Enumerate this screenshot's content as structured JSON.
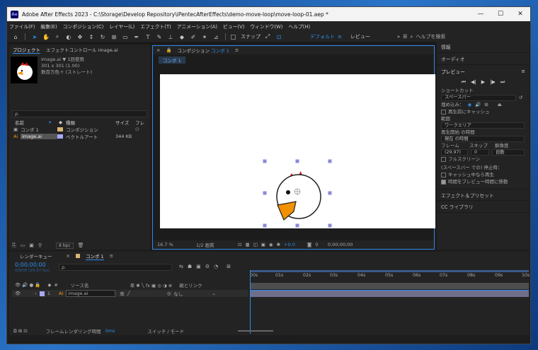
{
  "app": {
    "title": "Adobe After Effects 2023 - C:\\Storage\\Develop Repository\\iPentecAfterEffects\\demo-move-loop\\move-loop-01.aep *",
    "logo": "Ae"
  },
  "menu": [
    "ファイル(F)",
    "編集(E)",
    "コンポジション(C)",
    "レイヤー(L)",
    "エフェクト(T)",
    "アニメーション(A)",
    "ビュー(V)",
    "ウィンドウ(W)",
    "ヘルプ(H)"
  ],
  "toolbar": {
    "snap_label": "スナップ",
    "workspace_default": "デフォルト",
    "workspace_review": "レビュー",
    "help_search_placeholder": "ヘルプを検索"
  },
  "project": {
    "tab_project": "プロジェクト",
    "tab_effects": "エフェクトコントロール image.ai",
    "asset_name": "image.ai",
    "asset_used": "▼ 1回使用",
    "asset_size": "301 x 301 (1.00)",
    "asset_color": "数百万色＋ (ストレート)",
    "search_placeholder": "ρ.",
    "columns": [
      "名前",
      "種類",
      "サイズ",
      "フレ"
    ],
    "items": [
      {
        "name": "コンポ 1",
        "type": "コンポジション",
        "size": ""
      },
      {
        "name": "image.ai",
        "type": "ベクトルアート",
        "size": "344 KB"
      }
    ],
    "bpc": "8 bpc"
  },
  "composition": {
    "tab": "コンポジション",
    "tab_comp": "コンポ 1",
    "breadcrumb": "コンポ 1",
    "zoom": "16.7 %",
    "resolution": "1/2 画質",
    "exposure": "+0.0",
    "timecode": "0;00;00;00"
  },
  "side": {
    "info": "情報",
    "audio": "オーディオ",
    "preview": "プレビュー",
    "shortcut_label": "ショートカット",
    "shortcut_value": "スペースバー",
    "include_label": "埋め込み：",
    "cache_before": "再生前にキャッシュ",
    "range_label": "範囲",
    "range_value": "ワークエリア",
    "start_label": "再生開始 の時間",
    "start_value": "現在 の時間",
    "frame_label": "フレーム",
    "skip_label": "スキップ",
    "res_label": "解像度",
    "frame_value": "(29.97)",
    "skip_value": "0",
    "res_value": "自動",
    "fullscreen": "フルスクリーン",
    "stop_label": "(スペースバー での) 停止時：",
    "stop_cache": "キャッシュ中なら再生",
    "stop_time": "時間をプレビュー時間に移動",
    "effects_presets": "エフェクト＆プリセット",
    "cc_library": "CC ライブラリ"
  },
  "timeline": {
    "tab_render": "レンダーキュー",
    "tab_comp": "コンポ 1",
    "timecode": "0;00;00;00",
    "fps": "00000 (29.97 fps)",
    "col_source": "ソース名",
    "col_parent": "親とリンク",
    "layer_num": "1",
    "layer_name": "image.ai",
    "parent_value": "なし",
    "ticks": [
      "00s",
      "01s",
      "02s",
      "03s",
      "04s",
      "05s",
      "06s",
      "07s",
      "08s",
      "09s",
      "10s"
    ],
    "footer_render_label": "フレームレンダリング時間",
    "footer_render_value": "0ms",
    "footer_mode": "スイッチ / モード"
  }
}
